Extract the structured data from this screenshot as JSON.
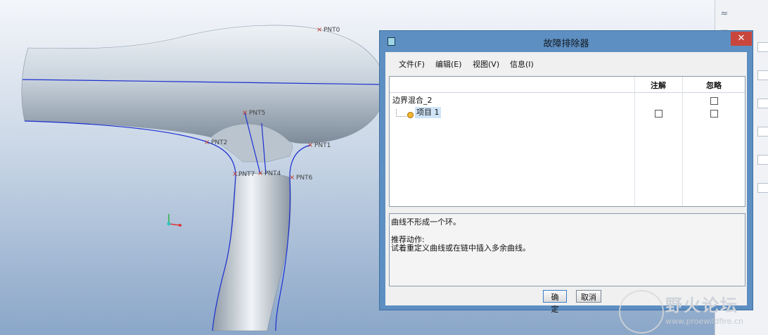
{
  "viewport": {
    "points": [
      {
        "id": "pnt0",
        "label": "PNT0"
      },
      {
        "id": "pnt1",
        "label": "PNT1"
      },
      {
        "id": "pnt2",
        "label": "PNT2"
      },
      {
        "id": "pnt4",
        "label": "PNT4"
      },
      {
        "id": "pnt5",
        "label": "PNT5"
      },
      {
        "id": "pnt6",
        "label": "PNT6"
      },
      {
        "id": "pnt7",
        "label": "PNT7"
      }
    ],
    "colors": {
      "edge": "#1c2fd0",
      "body": "#c9d3dd",
      "point": "#c0392b"
    }
  },
  "dialog": {
    "title": "故障排除器",
    "close_glyph": "✕",
    "menu": [
      "文件(F)",
      "编辑(E)",
      "视图(V)",
      "信息(I)"
    ],
    "columns": {
      "annotate": "注解",
      "ignore": "忽略"
    },
    "tree": {
      "root": "边界混合_2",
      "child": "项目 1"
    },
    "message": {
      "line1": "曲线不形成一个环。",
      "heading": "推荐动作:",
      "line2": "试着重定义曲线或在链中插入多余曲线。"
    },
    "buttons": {
      "ok": "确定",
      "cancel": "取消"
    }
  },
  "watermark": {
    "name": "野火论坛",
    "url": "www.proewildfire.cn"
  }
}
